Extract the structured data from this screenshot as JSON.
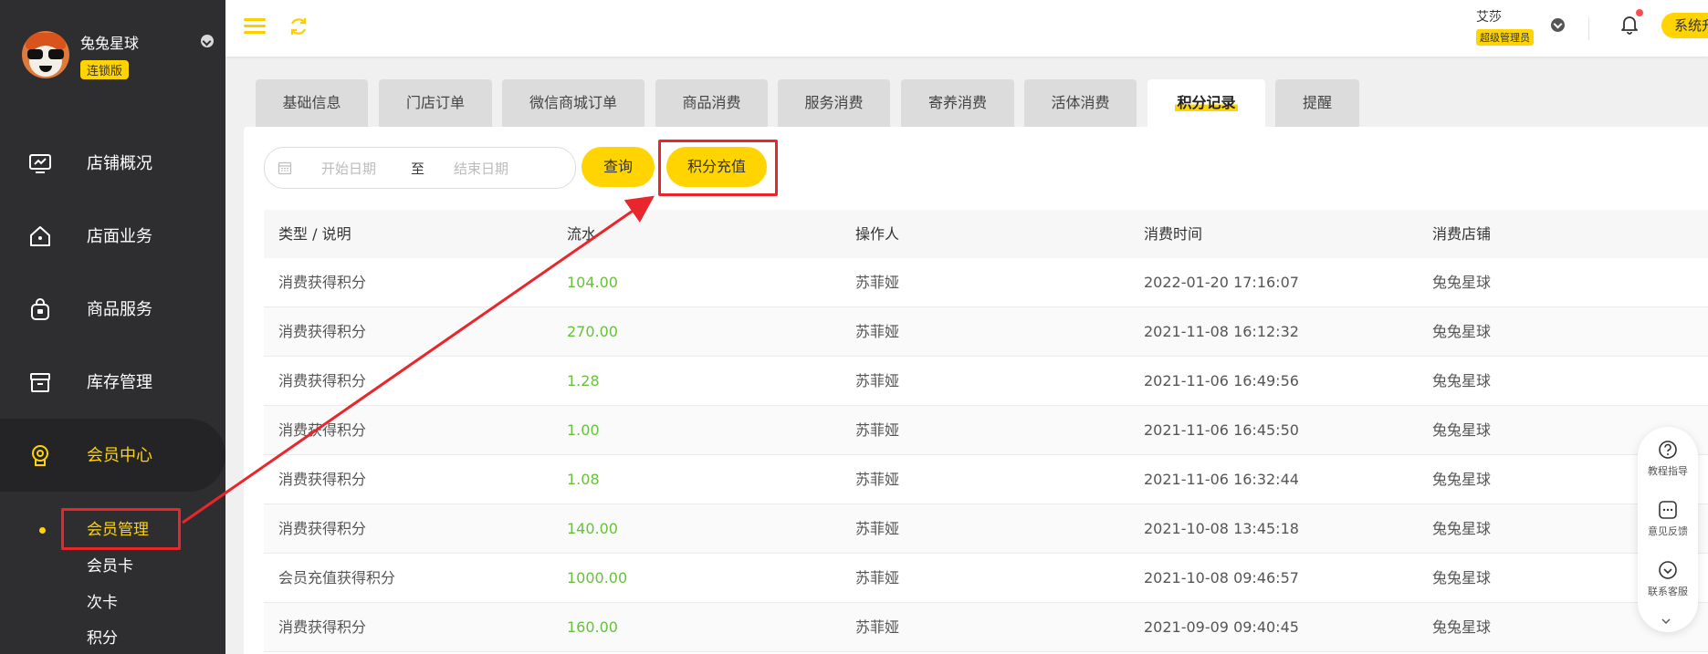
{
  "sidebar": {
    "profile": {
      "name": "兔兔星球",
      "badge": "连锁版"
    },
    "nav": [
      {
        "label": "店铺概况",
        "icon": "monitor-icon"
      },
      {
        "label": "店面业务",
        "icon": "home-icon"
      },
      {
        "label": "商品服务",
        "icon": "bag-icon"
      },
      {
        "label": "库存管理",
        "icon": "box-icon"
      },
      {
        "label": "会员中心",
        "icon": "member-icon"
      }
    ],
    "sub": [
      {
        "label": "会员管理"
      },
      {
        "label": "会员卡"
      },
      {
        "label": "次卡"
      },
      {
        "label": "积分"
      }
    ]
  },
  "header": {
    "user_name": "艾莎",
    "user_role": "超级管理员",
    "upgrade_label": "系统升"
  },
  "tabs": [
    {
      "label": "基础信息"
    },
    {
      "label": "门店订单"
    },
    {
      "label": "微信商城订单"
    },
    {
      "label": "商品消费"
    },
    {
      "label": "服务消费"
    },
    {
      "label": "寄养消费"
    },
    {
      "label": "活体消费"
    },
    {
      "label": "积分记录"
    },
    {
      "label": "提醒"
    }
  ],
  "filter": {
    "start_placeholder": "开始日期",
    "separator": "至",
    "end_placeholder": "结束日期",
    "query_label": "查询",
    "recharge_label": "积分充值"
  },
  "table": {
    "columns": [
      "类型 / 说明",
      "流水",
      "操作人",
      "消费时间",
      "消费店铺"
    ],
    "rows": [
      [
        "消费获得积分",
        "104.00",
        "苏菲娅",
        "2022-01-20 17:16:07",
        "兔兔星球"
      ],
      [
        "消费获得积分",
        "270.00",
        "苏菲娅",
        "2021-11-08 16:12:32",
        "兔兔星球"
      ],
      [
        "消费获得积分",
        "1.28",
        "苏菲娅",
        "2021-11-06 16:49:56",
        "兔兔星球"
      ],
      [
        "消费获得积分",
        "1.00",
        "苏菲娅",
        "2021-11-06 16:45:50",
        "兔兔星球"
      ],
      [
        "消费获得积分",
        "1.08",
        "苏菲娅",
        "2021-11-06 16:32:44",
        "兔兔星球"
      ],
      [
        "消费获得积分",
        "140.00",
        "苏菲娅",
        "2021-10-08 13:45:18",
        "兔兔星球"
      ],
      [
        "会员充值获得积分",
        "1000.00",
        "苏菲娅",
        "2021-10-08 09:46:57",
        "兔兔星球"
      ],
      [
        "消费获得积分",
        "160.00",
        "苏菲娅",
        "2021-09-09 09:40:45",
        "兔兔星球"
      ]
    ]
  },
  "float_help": [
    {
      "label": "教程指导",
      "icon": "question-icon"
    },
    {
      "label": "意见反馈",
      "icon": "feedback-icon"
    },
    {
      "label": "联系客服",
      "icon": "service-icon"
    }
  ],
  "colors": {
    "accent": "#ffd400",
    "sidebar_bg": "#2e2e30",
    "amount_green": "#67c23a",
    "annotation_red": "#e8262c"
  }
}
